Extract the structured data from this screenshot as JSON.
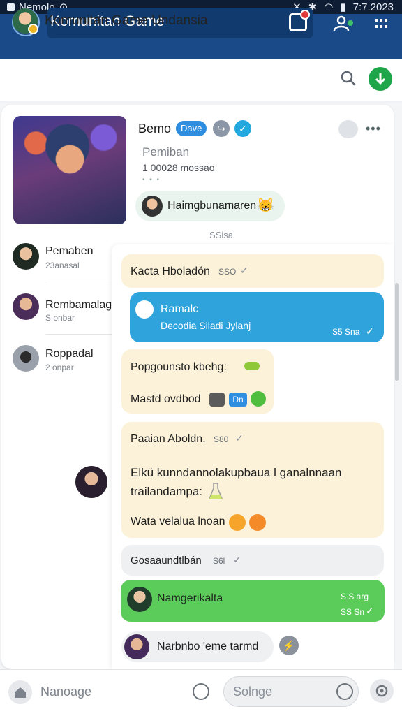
{
  "status_bar": {
    "carrier": "Nemolo",
    "time": "7:7.2023"
  },
  "app_bar": {
    "title": "Komunitan Game",
    "icons": [
      "avatar",
      "notification-icon",
      "people-icon",
      "menu-icon"
    ]
  },
  "header": {
    "title": "Komunitan Game Undansia",
    "icons": [
      "search-icon",
      "add-icon"
    ]
  },
  "post": {
    "name": "Bemo",
    "tag": "Dave",
    "subtitle": "Pemiban",
    "meta": "1 00028 mossao",
    "reaction_label": "Haimgbunamaren",
    "reaction_emoji": "😸",
    "time": "SSisa"
  },
  "members": [
    {
      "name": "Pemaben",
      "sub": "23anasal"
    },
    {
      "name": "Rembamalag",
      "sub": "S onbar"
    },
    {
      "name": "Roppadal",
      "sub": "2 onpar"
    }
  ],
  "chat": {
    "m1": {
      "text": "Kacta Hboladón",
      "meta": "SSO"
    },
    "m2": {
      "title": "Ramalc",
      "text": "Decodia Siladi Jylanj",
      "meta": "S5 Sna"
    },
    "m3": {
      "line1": "Popgounsto kbehg:",
      "line2": "Mastd ovdbod",
      "tag": "Dn"
    },
    "m4": {
      "header": "Paaian Aboldn.",
      "meta": "S80",
      "line1": "Elkü kunndannolakupbaua l ganalnnaan",
      "line2": "trailandampa:",
      "line3": "Wata velalua lnoan"
    },
    "m5": {
      "text": "Gosaaundtlbán",
      "meta": "S6l"
    },
    "m6": {
      "text": "Namgerikalta",
      "meta1": "S S arg",
      "meta2": "SS Sn"
    },
    "m7": {
      "text": "Narbnbo 'eme tarmd"
    }
  },
  "bottom_bar": {
    "message_placeholder": "Nanoage",
    "sticker_placeholder": "Solnge"
  },
  "colors": {
    "app_bar": "#1a4a87",
    "accent_green": "#1fa54a",
    "bubble_blue": "#2fa4dc",
    "bubble_green": "#5bcc5a",
    "bubble_cream": "#fbf2d9"
  }
}
